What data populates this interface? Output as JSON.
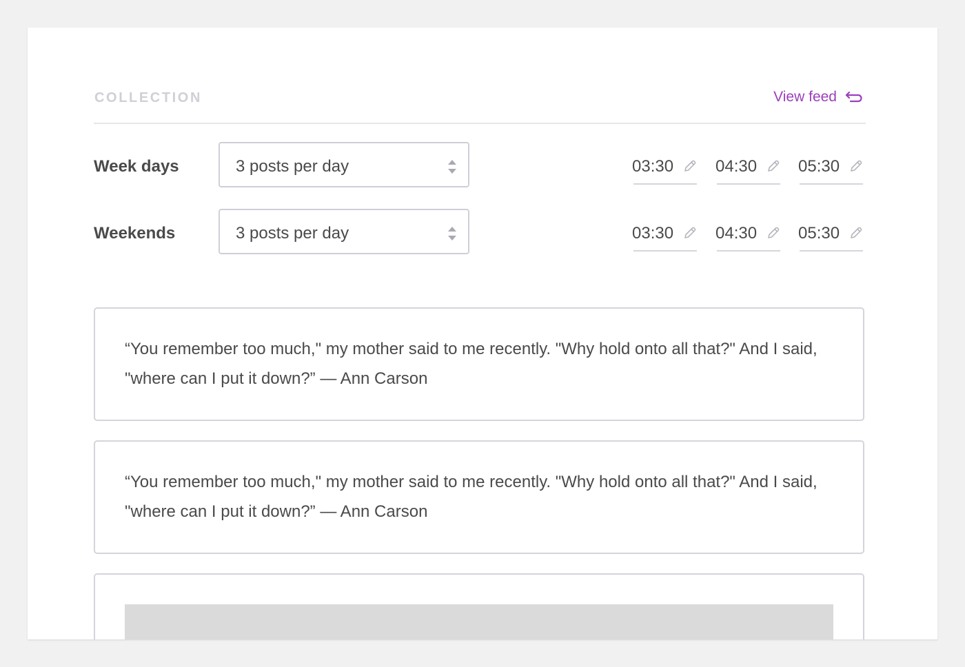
{
  "collection": {
    "title": "COLLECTION",
    "view_feed_label": "View feed",
    "view_feed_icon": "return-arrow-icon",
    "accent_color": "#9b3fbb"
  },
  "schedule": [
    {
      "label": "Week days",
      "frequency": "3 posts per day",
      "times": [
        "03:30",
        "04:30",
        "05:30"
      ]
    },
    {
      "label": "Weekends",
      "frequency": "3 posts per day",
      "times": [
        "03:30",
        "04:30",
        "05:30"
      ]
    }
  ],
  "posts": [
    {
      "text": "“You remember too much,\" my mother said to me recently. \"Why hold onto all that?\" And I said, \"where can I put it down?” — Ann Carson"
    },
    {
      "text": "“You remember too much,\" my mother said to me recently. \"Why hold onto all that?\" And I said, \"where can I put it down?” — Ann Carson"
    }
  ]
}
